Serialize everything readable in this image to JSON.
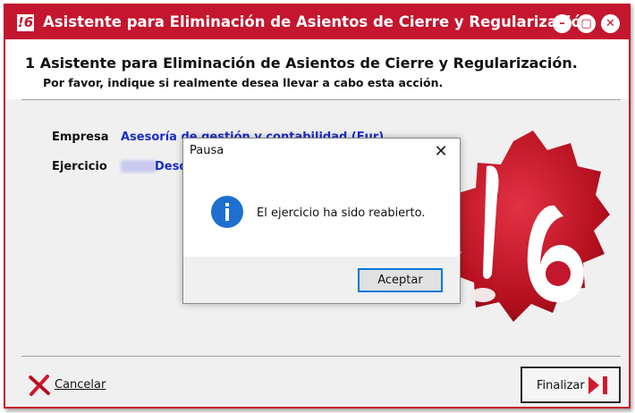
{
  "window": {
    "title": "Asistente para Eliminación de Asientos de Cierre y Regularización",
    "app_icon_glyph": "!6",
    "controls": {
      "minimize": "–",
      "maximize": "▢",
      "close": "✕"
    },
    "accent_color": "#c4162e"
  },
  "header": {
    "step_title": "1 Asistente para Eliminación de Asientos de Cierre y Regularización.",
    "subtitle": "Por favor, indique si realmente desea llevar a cabo esta acción."
  },
  "fields": {
    "empresa_label": "Empresa",
    "empresa_value": "Asesoría de gestión y contabilidad (Eur)",
    "ejercicio_label": "Ejercicio",
    "ejercicio_value": "Desd"
  },
  "footer": {
    "cancel_label": "Cancelar",
    "finish_label": "Finalizar"
  },
  "dialog": {
    "title": "Pausa",
    "close_glyph": "✕",
    "icon": "info-icon",
    "message": "El ejercicio ha sido reabierto.",
    "ok_label": "Aceptar"
  }
}
